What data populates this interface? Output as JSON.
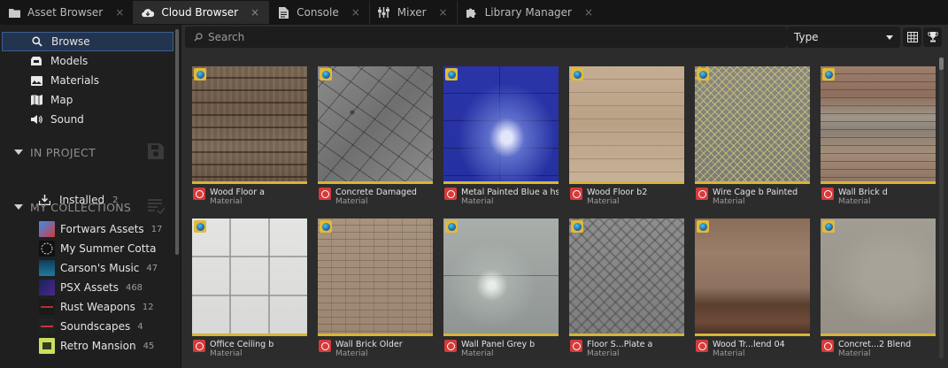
{
  "tabs": [
    {
      "label": "Asset Browser",
      "icon": "folder-icon",
      "active": false
    },
    {
      "label": "Cloud Browser",
      "icon": "cloud-download-icon",
      "active": true
    },
    {
      "label": "Console",
      "icon": "document-icon",
      "active": false
    },
    {
      "label": "Mixer",
      "icon": "sliders-icon",
      "active": false
    },
    {
      "label": "Library Manager",
      "icon": "puzzle-icon",
      "active": false
    }
  ],
  "tab_close_glyph": "×",
  "sidebar": {
    "nav": [
      {
        "label": "Browse",
        "icon": "search-icon",
        "active": true
      },
      {
        "label": "Models",
        "icon": "models-icon",
        "active": false
      },
      {
        "label": "Materials",
        "icon": "image-icon",
        "active": false
      },
      {
        "label": "Map",
        "icon": "map-icon",
        "active": false
      },
      {
        "label": "Sound",
        "icon": "speaker-icon",
        "active": false
      }
    ],
    "in_project": {
      "title": "IN PROJECT",
      "installed_label": "Installed",
      "installed_count": "2"
    },
    "collections": {
      "title": "MY COLLECTIONS",
      "items": [
        {
          "label": "Fortwars Assets",
          "count": "17",
          "thumb_color": "#2a6fd6"
        },
        {
          "label": "My Summer Cotta",
          "count": "",
          "thumb_color": "#111111"
        },
        {
          "label": "Carson's Music",
          "count": "47",
          "thumb_color": "#15506e"
        },
        {
          "label": "PSX Assets",
          "count": "468",
          "thumb_color": "#1b1f5c"
        },
        {
          "label": "Rust Weapons",
          "count": "12",
          "thumb_color": "#1a1a1a"
        },
        {
          "label": "Soundscapes",
          "count": "4",
          "thumb_color": "#222222"
        },
        {
          "label": "Retro Mansion",
          "count": "45",
          "thumb_color": "#c8e060"
        }
      ]
    }
  },
  "toolbar": {
    "search_placeholder": "Search",
    "type_label": "Type"
  },
  "assets": [
    {
      "name": "Wood Floor a",
      "kind": "Material"
    },
    {
      "name": "Concrete Damaged",
      "kind": "Material"
    },
    {
      "name": "Metal Painted Blue a hs",
      "kind": "Material"
    },
    {
      "name": "Wood Floor b2",
      "kind": "Material"
    },
    {
      "name": "Wire Cage b Painted",
      "kind": "Material"
    },
    {
      "name": "Wall Brick d",
      "kind": "Material"
    },
    {
      "name": "Office Ceiling b",
      "kind": "Material"
    },
    {
      "name": "Wall Brick Older",
      "kind": "Material"
    },
    {
      "name": "Wall Panel Grey b",
      "kind": "Material"
    },
    {
      "name": "Floor S...Plate a",
      "kind": "Material"
    },
    {
      "name": "Wood Tr...lend 04",
      "kind": "Material"
    },
    {
      "name": "Concret...2 Blend",
      "kind": "Material"
    }
  ],
  "colors": {
    "accent_gold": "#d8b436",
    "active_blue": "#23344f",
    "unreal_red": "#d63a3a"
  }
}
